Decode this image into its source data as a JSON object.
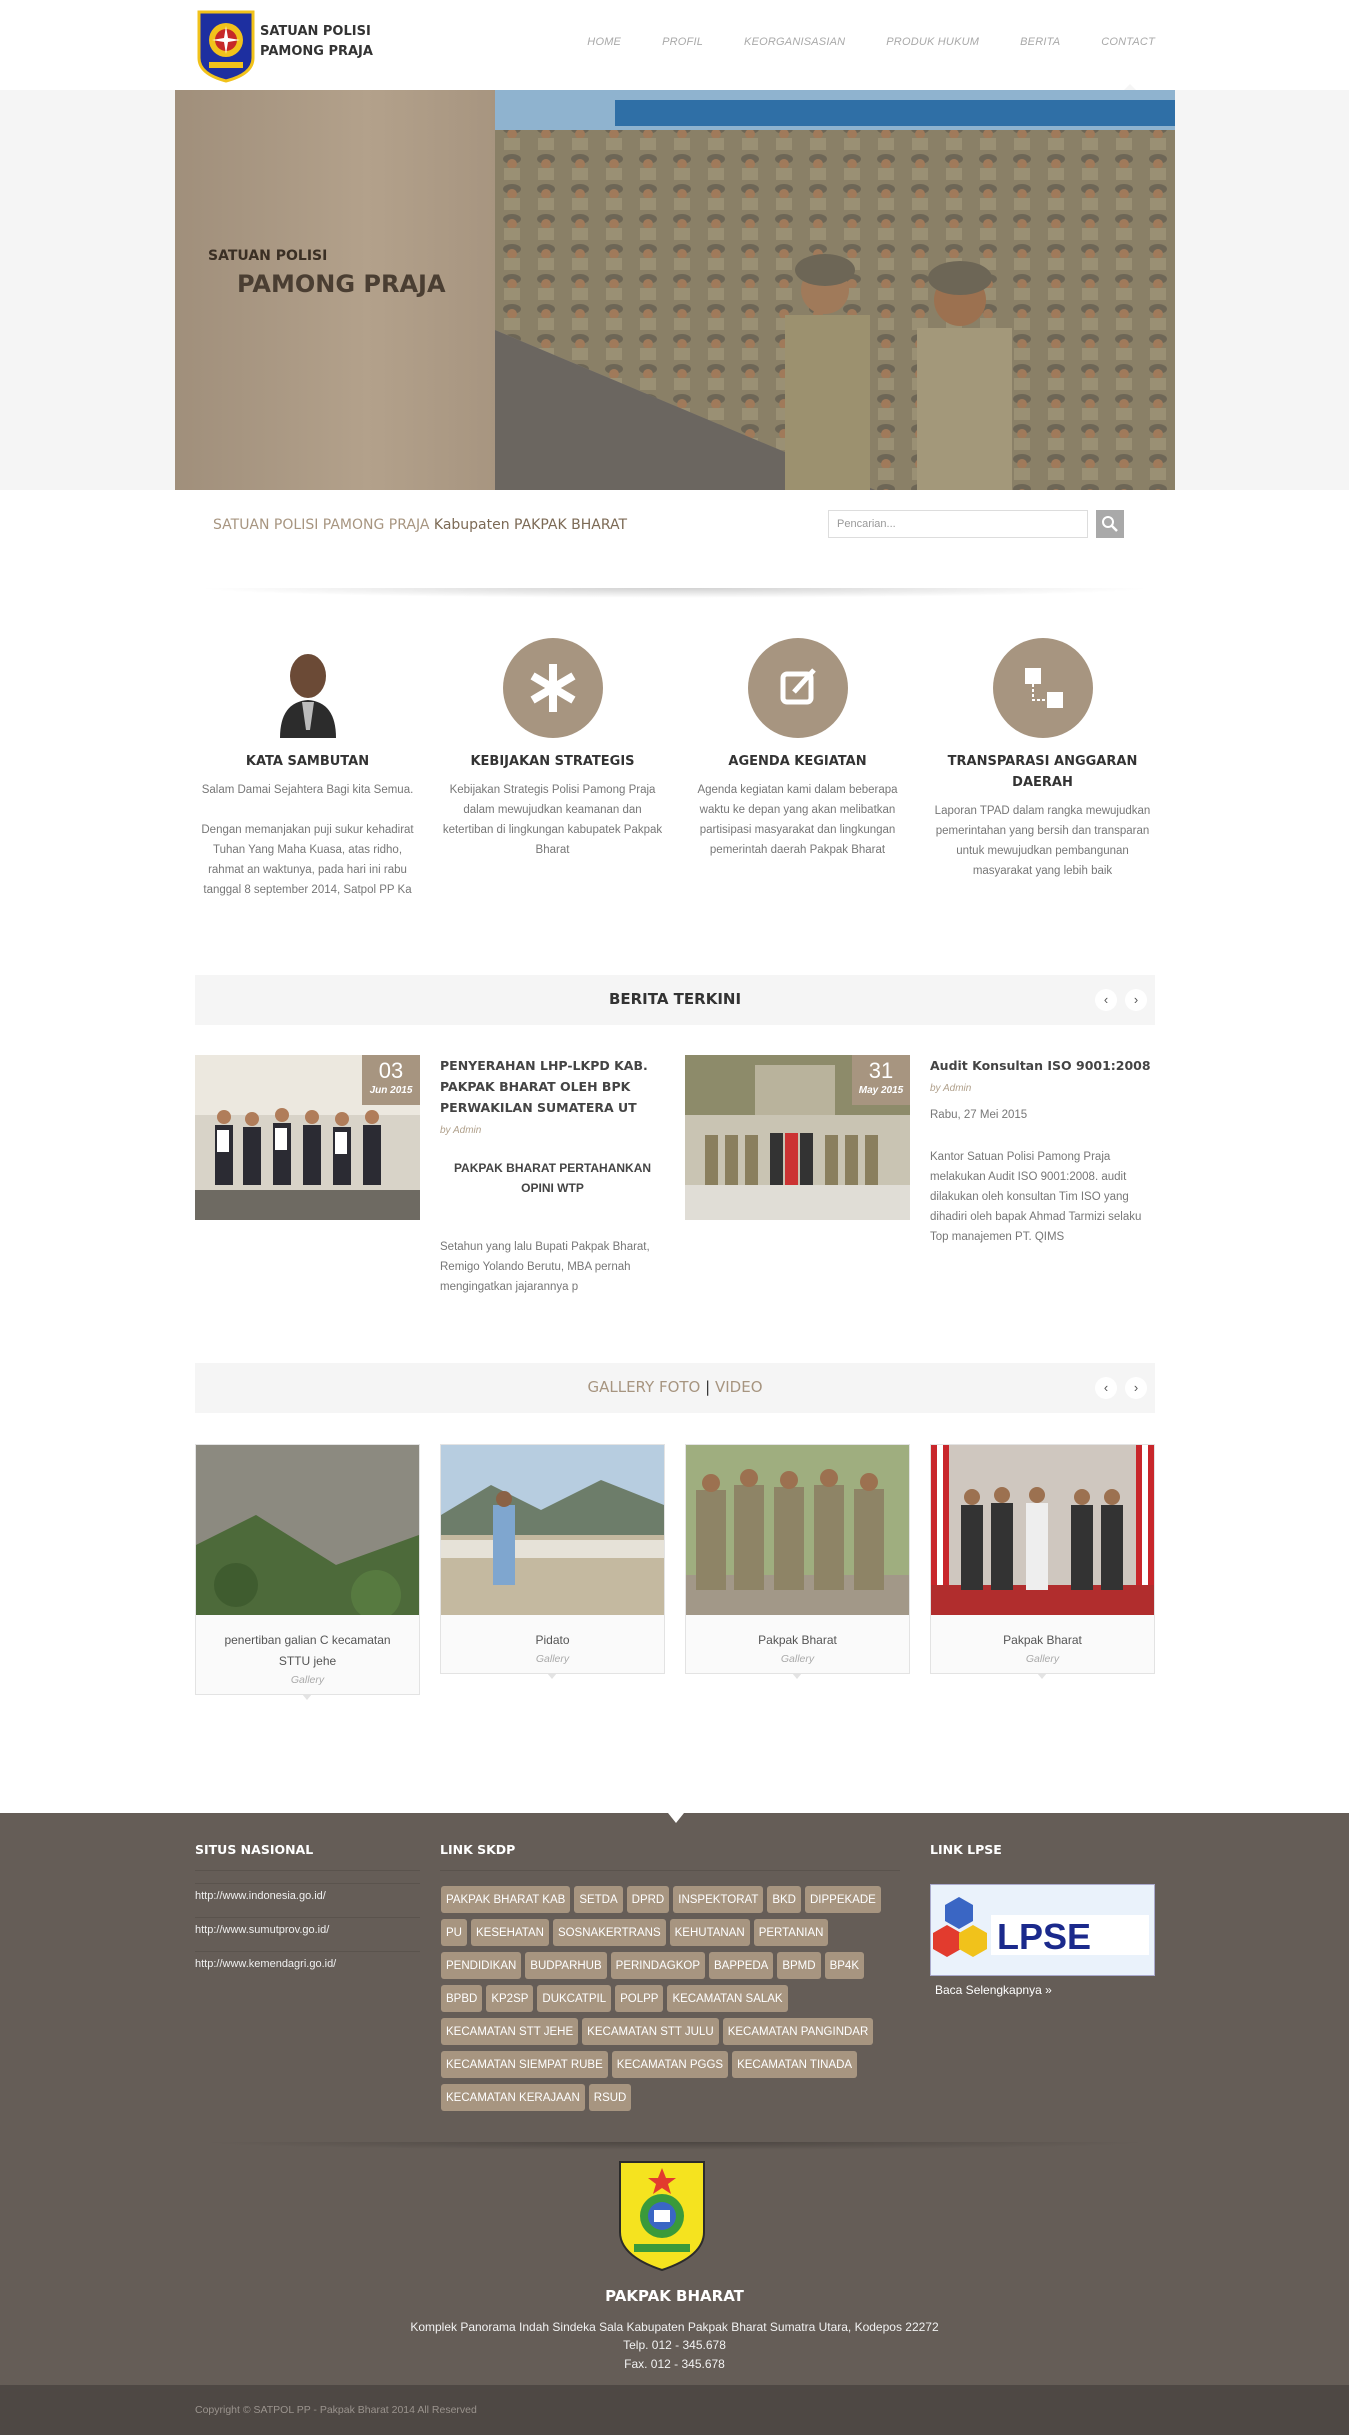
{
  "brand": {
    "line1": "SATUAN POLISI",
    "line2": "PAMONG PRAJA"
  },
  "nav": [
    "HOME",
    "PROFIL",
    "KEORGANISASIAN",
    "PRODUK HUKUM",
    "BERITA",
    "CONTACT"
  ],
  "hero": {
    "line1": "SATUAN POLISI",
    "line2": "PAMONG PRAJA"
  },
  "tagline": {
    "part1": "SATUAN POLISI PAMONG PRAJA",
    "part2": "Kabupaten PAKPAK BHARAT"
  },
  "search": {
    "placeholder": "Pencarian..."
  },
  "features": [
    {
      "icon": "person-icon",
      "title": "KATA SAMBUTAN",
      "text": "Salam Damai Sejahtera Bagi kita Semua.\n\nDengan memanjakan puji sukur kehadirat Tuhan Yang Maha Kuasa, atas ridho, rahmat an waktunya, pada hari ini rabu tanggal 8 september 2014, Satpol PP Ka"
    },
    {
      "icon": "asterisk-icon",
      "title": "KEBIJAKAN STRATEGIS",
      "text": "Kebijakan Strategis Polisi Pamong Praja dalam mewujudkan keamanan dan ketertiban di lingkungan kabupatek Pakpak Bharat"
    },
    {
      "icon": "edit-icon",
      "title": "AGENDA KEGIATAN",
      "text": "Agenda kegiatan kami dalam beberapa waktu ke depan yang akan melibatkan partisipasi masyarakat dan lingkungan pemerintah daerah Pakpak Bharat"
    },
    {
      "icon": "sitemap-icon",
      "title": "TRANSPARASI ANGGARAN DAERAH",
      "text": "Laporan TPAD dalam rangka mewujudkan pemerintahan yang bersih dan transparan untuk mewujudkan pembangunan masyarakat yang lebih baik"
    }
  ],
  "news_section": {
    "title": "BERITA TERKINI",
    "prev": "‹",
    "next": "›"
  },
  "news": [
    {
      "day": "03",
      "month": "Jun 2015",
      "title": "PENYERAHAN LHP-LKPD KAB. PAKPAK BHARAT OLEH BPK PERWAKILAN SUMATERA UT",
      "by": "by Admin",
      "subtitle": "PAKPAK BHARAT PERTAHANKAN OPINI WTP",
      "text": "Setahun yang lalu Bupati Pakpak Bharat, Remigo Yolando Berutu, MBA pernah mengingatkan jajarannya p"
    },
    {
      "day": "31",
      "month": "May 2015",
      "title": "Audit Konsultan ISO 9001:2008",
      "by": "by Admin",
      "subtitle": "Rabu, 27 Mei 2015",
      "text": "Kantor Satuan Polisi Pamong Praja melakukan Audit ISO 9001:2008. audit dilakukan oleh konsultan Tim ISO yang dihadiri oleh bapak Ahmad Tarmizi selaku Top manajemen PT. QIMS"
    }
  ],
  "gallery_section": {
    "title_a": "GALLERY FOTO",
    "sep": "|",
    "title_b": "VIDEO",
    "prev": "‹",
    "next": "›"
  },
  "gallery": [
    {
      "caption": "penertiban galian C kecamatan STTU jehe",
      "category": "Gallery"
    },
    {
      "caption": "Pidato",
      "category": "Gallery"
    },
    {
      "caption": "Pakpak Bharat",
      "category": "Gallery"
    },
    {
      "caption": "Pakpak Bharat",
      "category": "Gallery"
    }
  ],
  "footer": {
    "situs_title": "SITUS NASIONAL",
    "situs_links": [
      "http://www.indonesia.go.id/",
      "http://www.sumutprov.go.id/",
      "http://www.kemendagri.go.id/"
    ],
    "skpd_title": "LINK SKDP",
    "skpd_tags": [
      "PAKPAK BHARAT KAB",
      "SETDA",
      "DPRD",
      "INSPEKTORAT",
      "BKD",
      "DIPPEKADE",
      "PU",
      "KESEHATAN",
      "SOSNAKERTRANS",
      "KEHUTANAN",
      "PERTANIAN",
      "PENDIDIKAN",
      "BUDPARHUB",
      "PERINDAGKOP",
      "BAPPEDA",
      "BPMD",
      "BP4K",
      "BPBD",
      "KP2SP",
      "DUKCATPIL",
      "POLPP",
      "KECAMATAN SALAK",
      "KECAMATAN STT JEHE",
      "KECAMATAN STT JULU",
      "KECAMATAN PANGINDAR",
      "KECAMATAN SIEMPAT RUBE",
      "KECAMATAN PGGS",
      "KECAMATAN TINADA",
      "KECAMATAN KERAJAAN",
      "RSUD"
    ],
    "lpse_title": "LINK LPSE",
    "lpse_text": "LPSE",
    "read_more": "Baca Selengkapnya »",
    "region": "PAKPAK BHARAT",
    "address": "Komplek Panorama Indah Sindeka Sala Kabupaten Pakpak Bharat Sumatra Utara, Kodepos 22272",
    "phone": "Telp. 012 - 345.678",
    "fax": "Fax. 012 - 345.678",
    "copyright": "Copyright © SATPOL PP - Pakpak Bharat 2014 All Reserved"
  }
}
